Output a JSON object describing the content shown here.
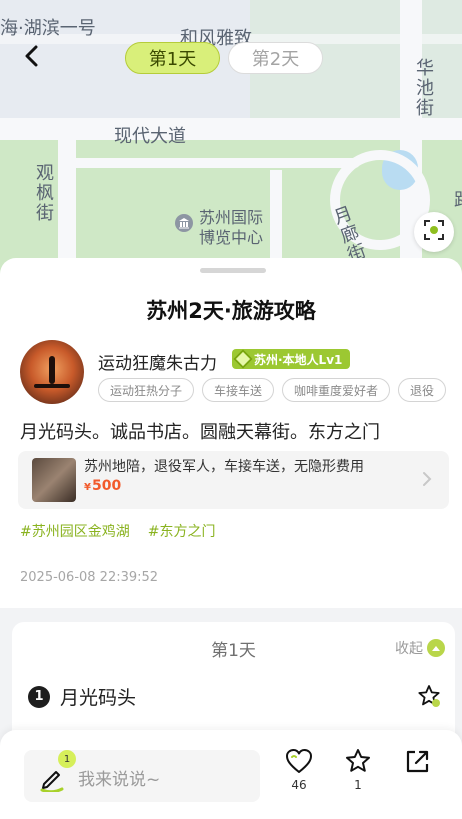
{
  "map": {
    "labels": {
      "top_left": "海·湖滨一号",
      "top_center": "和风雅致",
      "road_main": "现代大道",
      "road_left": "观枫街",
      "poi": "苏州国际博览中心",
      "road_right_top": "华池街",
      "road_right_bottom": "月廊街",
      "road_edge": "路"
    },
    "icons": {
      "back": "chevron-left-icon",
      "locate": "locate-icon",
      "poi": "museum-icon"
    }
  },
  "day_tabs": [
    {
      "label": "第1天",
      "active": true
    },
    {
      "label": "第2天",
      "active": false
    }
  ],
  "post": {
    "title": "苏州2天·旅游攻略",
    "author": {
      "name": "运动狂魔朱古力",
      "badge": "苏州·本地人Lv1",
      "tags": [
        "运动狂热分子",
        "车接车送",
        "咖啡重度爱好者",
        "退役"
      ]
    },
    "content": "月光码头。诚品书店。圆融天幕街。东方之门",
    "ad": {
      "text": "苏州地陪，退役军人，车接车送，无隐形费用",
      "currency": "¥",
      "price": "500"
    },
    "hashtags": [
      "#苏州园区金鸡湖",
      "#东方之门"
    ],
    "timestamp": "2025-06-08 22:39:52"
  },
  "itinerary": {
    "day_title": "第1天",
    "collapse_label": "收起",
    "spots": [
      {
        "index": "1",
        "name": "月光码头"
      }
    ]
  },
  "bottom_bar": {
    "comment_placeholder": "我来说说~",
    "comment_badge": "1",
    "like_count": "46",
    "favorite_count": "1"
  },
  "colors": {
    "accent": "#9cc832",
    "price": "#f25a2b",
    "tab_active": "#d9ef7a"
  }
}
